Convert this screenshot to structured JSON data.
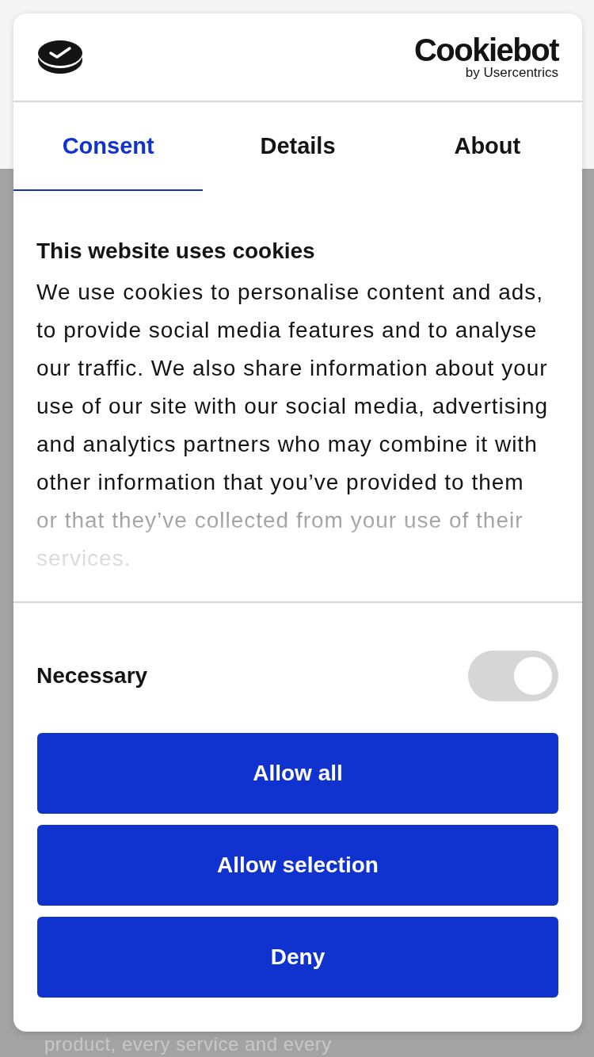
{
  "brand": {
    "name": "Cookiebot",
    "tagline": "by Usercentrics"
  },
  "tabs": [
    {
      "label": "Consent",
      "selected": true
    },
    {
      "label": "Details",
      "selected": false
    },
    {
      "label": "About",
      "selected": false
    }
  ],
  "notice": {
    "title": "This website uses cookies",
    "body": "We use cookies to personalise content and ads, to provide social media features and to analyse our traffic. We also share information about your use of our site with our social media, advertising and analytics partners who may combine it with other information that you’ve provided to them or that they’ve collected from your use of their services."
  },
  "categories": [
    {
      "label": "Necessary",
      "on": true,
      "disabled": true
    }
  ],
  "buttons": [
    "Allow all",
    "Allow selection",
    "Deny"
  ],
  "background_text": "product, every service and every"
}
